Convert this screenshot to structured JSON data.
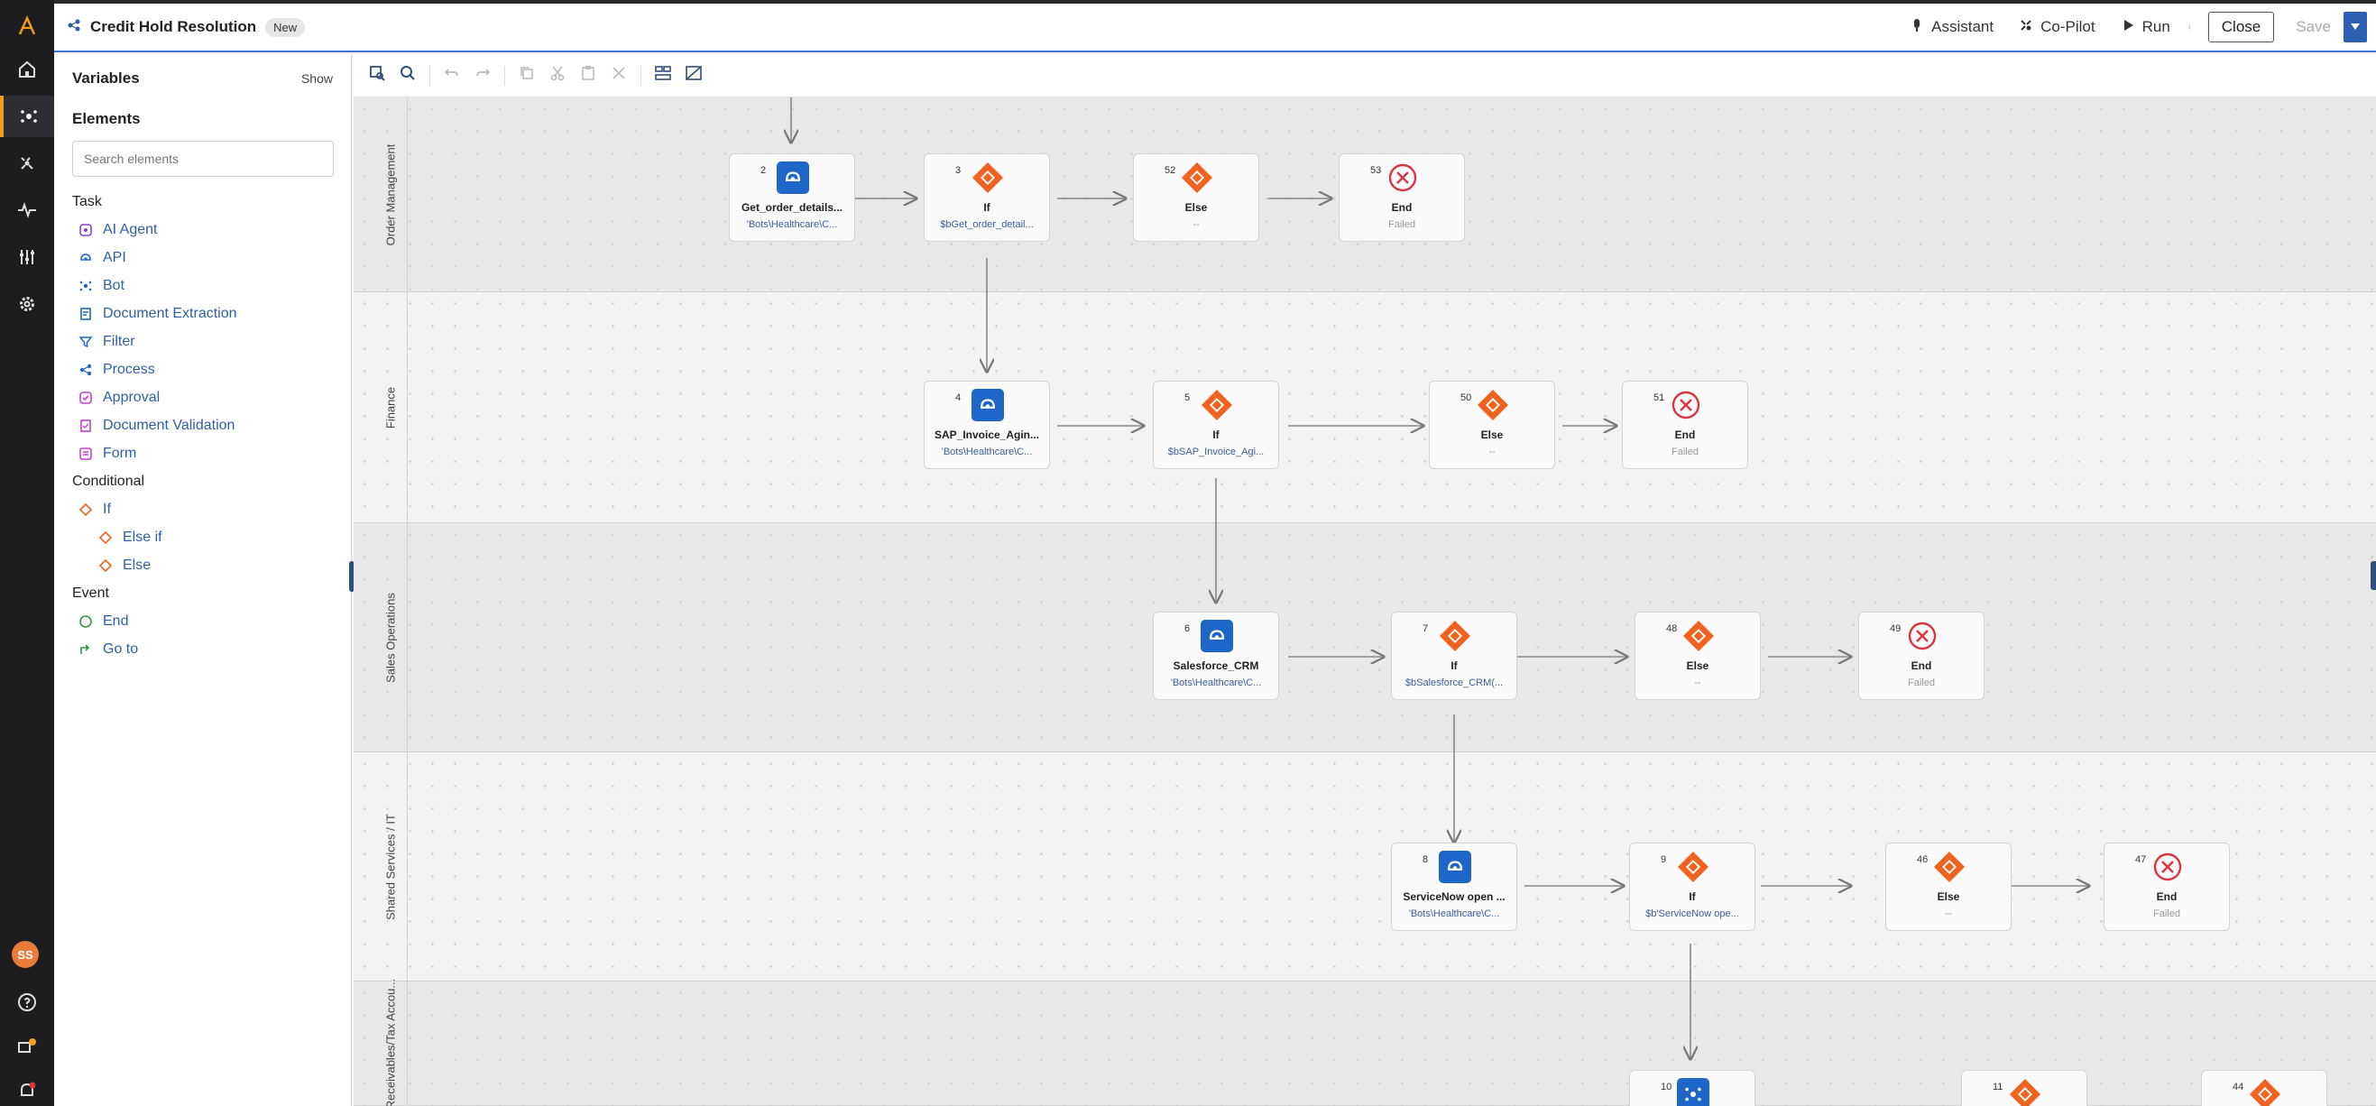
{
  "header": {
    "title": "Credit Hold Resolution",
    "badge": "New",
    "assistant_label": "Assistant",
    "copilot_label": "Co-Pilot",
    "run_label": "Run",
    "close_label": "Close",
    "save_label": "Save"
  },
  "rail": {
    "avatar_initials": "SS"
  },
  "panel": {
    "variables_title": "Variables",
    "show_label": "Show",
    "elements_title": "Elements",
    "search_placeholder": "Search elements",
    "groups": {
      "task": "Task",
      "conditional": "Conditional",
      "event": "Event"
    },
    "task_items": [
      "AI Agent",
      "API",
      "Bot",
      "Document Extraction",
      "Filter",
      "Process",
      "Approval",
      "Document Validation",
      "Form"
    ],
    "conditional_items": [
      "If",
      "Else if",
      "Else"
    ],
    "event_items": [
      "End",
      "Go to"
    ]
  },
  "lanes": [
    "Order Management",
    "Finance",
    "Sales Operations",
    "Shared Services / IT",
    "Receivables/Tax Accou..."
  ],
  "nodes": [
    {
      "num": "2",
      "name": "Get_order_details...",
      "sub": "'Bots\\Healthcare\\C...",
      "kind": "api"
    },
    {
      "num": "3",
      "name": "If",
      "sub": "$bGet_order_detail...",
      "kind": "if"
    },
    {
      "num": "52",
      "name": "Else",
      "sub": "--",
      "kind": "else"
    },
    {
      "num": "53",
      "name": "End",
      "sub": "Failed",
      "kind": "end"
    },
    {
      "num": "4",
      "name": "SAP_Invoice_Agin...",
      "sub": "'Bots\\Healthcare\\C...",
      "kind": "api"
    },
    {
      "num": "5",
      "name": "If",
      "sub": "$bSAP_Invoice_Agi...",
      "kind": "if"
    },
    {
      "num": "50",
      "name": "Else",
      "sub": "--",
      "kind": "else"
    },
    {
      "num": "51",
      "name": "End",
      "sub": "Failed",
      "kind": "end"
    },
    {
      "num": "6",
      "name": "Salesforce_CRM",
      "sub": "'Bots\\Healthcare\\C...",
      "kind": "api"
    },
    {
      "num": "7",
      "name": "If",
      "sub": "$bSalesforce_CRM(...",
      "kind": "if"
    },
    {
      "num": "48",
      "name": "Else",
      "sub": "--",
      "kind": "else"
    },
    {
      "num": "49",
      "name": "End",
      "sub": "Failed",
      "kind": "end"
    },
    {
      "num": "8",
      "name": "ServiceNow open ...",
      "sub": "'Bots\\Healthcare\\C...",
      "kind": "api"
    },
    {
      "num": "9",
      "name": "If",
      "sub": "$b'ServiceNow ope...",
      "kind": "if"
    },
    {
      "num": "46",
      "name": "Else",
      "sub": "--",
      "kind": "else"
    },
    {
      "num": "47",
      "name": "End",
      "sub": "Failed",
      "kind": "end"
    },
    {
      "num": "10",
      "name": "",
      "sub": "",
      "kind": "bot"
    },
    {
      "num": "11",
      "name": "",
      "sub": "",
      "kind": "if"
    },
    {
      "num": "44",
      "name": "",
      "sub": "",
      "kind": "if"
    }
  ],
  "colors": {
    "accent": "#f39c1e",
    "primary_blue": "#1e67c8",
    "if_orange": "#f0621f",
    "end_red": "#d9363e",
    "link_blue": "#2e5fa3"
  }
}
